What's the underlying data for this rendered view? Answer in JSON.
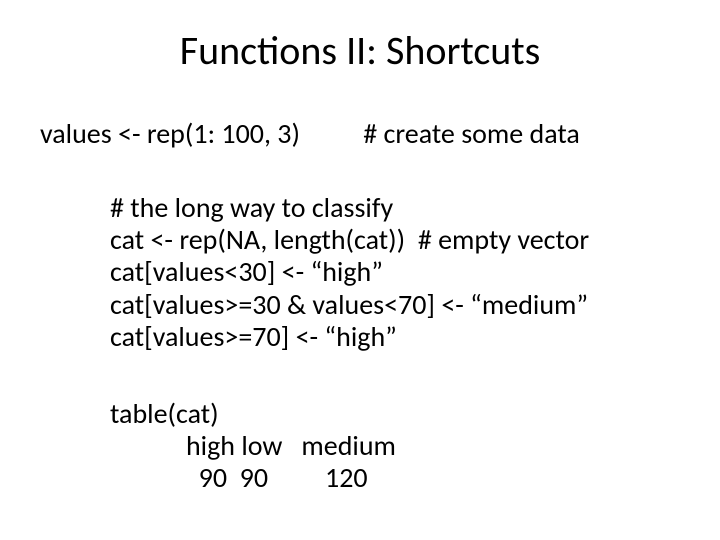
{
  "title": "Functions II: Shortcuts",
  "line1": "values <- rep(1: 100, 3)          # create some data",
  "block2": "# the long way to classify\ncat <- rep(NA, length(cat))  # empty vector\ncat[values<30] <- “high”\ncat[values>=30 & values<70] <- “medium”\ncat[values>=70] <- “high”",
  "block3": "table(cat)\n            high low   medium\n              90  90         120"
}
